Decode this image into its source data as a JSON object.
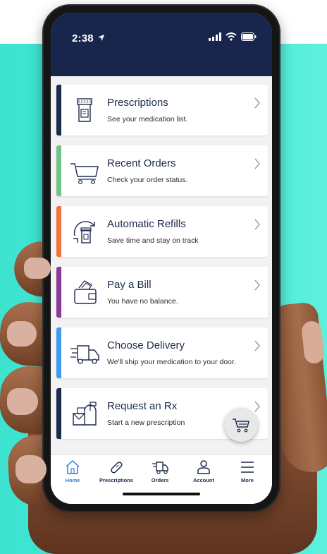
{
  "status_bar": {
    "time": "2:38"
  },
  "menu": [
    {
      "title": "Prescriptions",
      "subtitle": "See your medication list.",
      "icon": "prescription-bottle-icon",
      "accent": "#1b2a4d"
    },
    {
      "title": "Recent Orders",
      "subtitle": "Check your order status.",
      "icon": "shopping-cart-icon",
      "accent": "#71c38a"
    },
    {
      "title": "Automatic Refills",
      "subtitle": "Save time and stay on track",
      "icon": "refill-icon",
      "accent": "#f2743b"
    },
    {
      "title": "Pay a Bill",
      "subtitle": "You have no balance.",
      "icon": "wallet-icon",
      "accent": "#8a3b97"
    },
    {
      "title": "Choose Delivery",
      "subtitle": "We'll ship your medication to your door.",
      "icon": "delivery-truck-icon",
      "accent": "#3f9bf0"
    },
    {
      "title": "Request an Rx",
      "subtitle": "Start a new prescription",
      "icon": "mailbox-icon",
      "accent": "#1b2a4d"
    }
  ],
  "tabs": [
    {
      "label": "Home",
      "icon": "home-icon",
      "active": true
    },
    {
      "label": "Prescriptions",
      "icon": "pill-icon",
      "active": false
    },
    {
      "label": "Orders",
      "icon": "truck-icon",
      "active": false
    },
    {
      "label": "Account",
      "icon": "person-icon",
      "active": false
    },
    {
      "label": "More",
      "icon": "menu-icon",
      "active": false
    }
  ],
  "colors": {
    "header": "#18254d",
    "background_gradient_start": "#3ee3d0",
    "background_gradient_end": "#5df0dc",
    "active_tab": "#2c7de0"
  }
}
